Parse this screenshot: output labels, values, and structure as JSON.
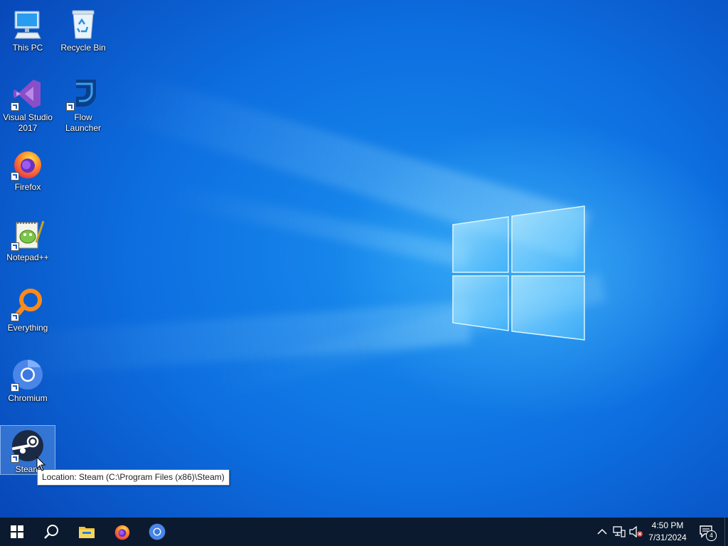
{
  "desktop": {
    "icons": [
      {
        "label": "This PC",
        "icon": "this-pc-icon"
      },
      {
        "label": "Recycle Bin",
        "icon": "recycle-bin-icon"
      },
      {
        "label": "Visual Studio 2017",
        "icon": "visual-studio-icon"
      },
      {
        "label": "Flow Launcher",
        "icon": "flow-launcher-icon"
      },
      {
        "label": "Firefox",
        "icon": "firefox-icon"
      },
      {
        "label": "Notepad++",
        "icon": "notepad-plus-plus-icon"
      },
      {
        "label": "Everything",
        "icon": "everything-icon"
      },
      {
        "label": "Chromium",
        "icon": "chromium-icon"
      },
      {
        "label": "Steam",
        "icon": "steam-icon",
        "selected": true
      }
    ],
    "tooltip": "Location: Steam (C:\\Program Files (x86)\\Steam)"
  },
  "taskbar": {
    "buttons": [
      {
        "name": "start",
        "icon": "windows-start-icon"
      },
      {
        "name": "search",
        "icon": "search-icon"
      },
      {
        "name": "file-explorer",
        "icon": "folder-icon"
      },
      {
        "name": "firefox",
        "icon": "firefox-icon"
      },
      {
        "name": "chromium",
        "icon": "chromium-icon"
      }
    ],
    "tray": {
      "time": "4:50 PM",
      "date": "7/31/2024",
      "notification_count": "4",
      "icons": [
        "chevron-up-icon",
        "network-icon",
        "speaker-muted-icon",
        "action-center-icon"
      ]
    }
  },
  "colors": {
    "taskbar": "#0b1a2e",
    "desktop_accent": "#0d6fe0"
  }
}
